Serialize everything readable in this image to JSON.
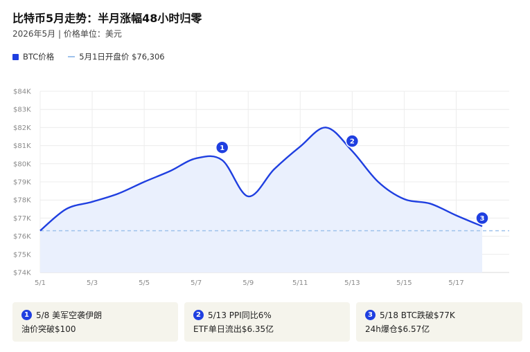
{
  "header": {
    "title": "比特币5月走势：半月涨幅48小时归零",
    "subtitle": "2026年5月 | 价格单位：美元"
  },
  "legend": {
    "series_label": "BTC价格",
    "reference_label": "5月1日开盘价 $76,306"
  },
  "colors": {
    "line": "#1f3fe0",
    "area": "#eaf0fd",
    "reference": "#9ec2ec",
    "grid": "#ececec",
    "card_bg": "#f5f4ec"
  },
  "chart_data": {
    "type": "area",
    "x": [
      "5/1",
      "5/2",
      "5/3",
      "5/4",
      "5/5",
      "5/6",
      "5/7",
      "5/8",
      "5/9",
      "5/10",
      "5/11",
      "5/12",
      "5/13",
      "5/14",
      "5/15",
      "5/16",
      "5/17",
      "5/18"
    ],
    "x_ticks": [
      "5/1",
      "5/3",
      "5/5",
      "5/7",
      "5/9",
      "5/11",
      "5/13",
      "5/15",
      "5/17"
    ],
    "series": [
      {
        "name": "BTC价格",
        "values": [
          76306,
          77500,
          77900,
          78350,
          79000,
          79600,
          80300,
          80200,
          78200,
          79700,
          80950,
          82000,
          80700,
          79000,
          78050,
          77800,
          77150,
          76550
        ]
      }
    ],
    "reference_line": {
      "value": 76306,
      "label": "5月1日开盘价 $76,306"
    },
    "ylim": [
      74000,
      84000
    ],
    "y_ticks": [
      74000,
      75000,
      76000,
      77000,
      78000,
      79000,
      80000,
      81000,
      82000,
      83000,
      84000
    ],
    "y_tick_labels": [
      "$74K",
      "$75K",
      "$76K",
      "$77K",
      "$78K",
      "$79K",
      "$80K",
      "$81K",
      "$82K",
      "$83K",
      "$84K"
    ],
    "grid": true,
    "legend_position": "top-left",
    "markers": [
      {
        "label": "1",
        "x": "5/8",
        "y": 80900
      },
      {
        "label": "2",
        "x": "5/13",
        "y": 81250
      },
      {
        "label": "3",
        "x": "5/18",
        "y": 77000
      }
    ]
  },
  "annotations": [
    {
      "num": "1",
      "line1": "5/8 美军空袭伊朗",
      "line2": "油价突破$100"
    },
    {
      "num": "2",
      "line1": "5/13 PPI同比6%",
      "line2": "ETF单日流出$6.35亿"
    },
    {
      "num": "3",
      "line1": "5/18 BTC跌破$77K",
      "line2": "24h爆仓$6.57亿"
    }
  ]
}
